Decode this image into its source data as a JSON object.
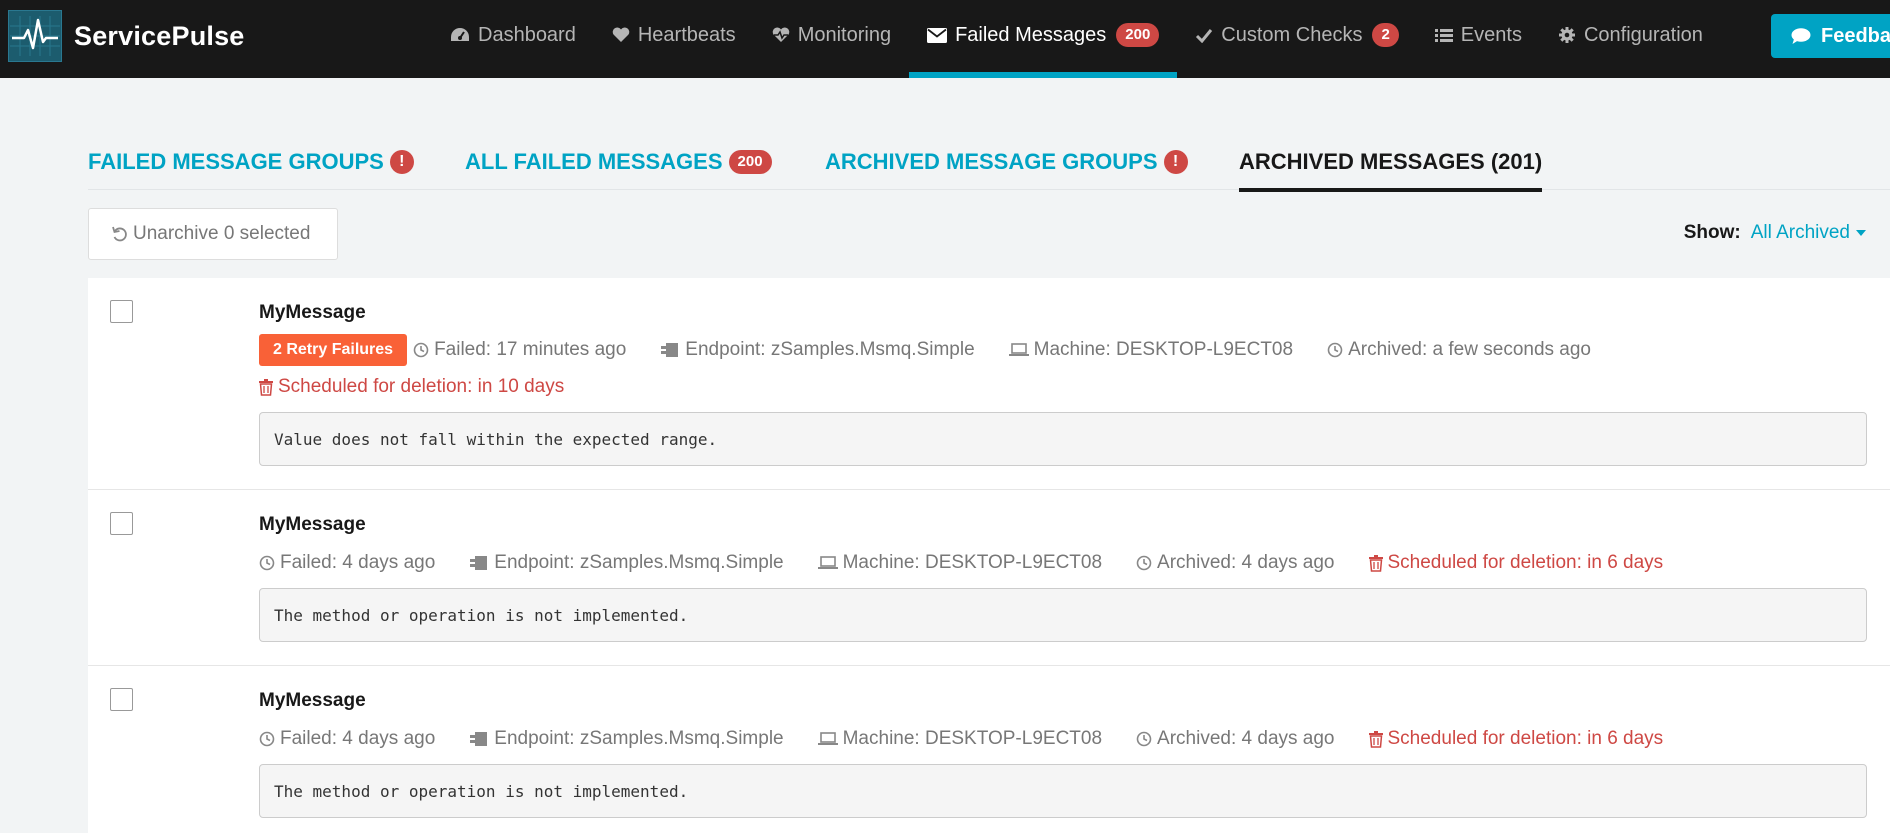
{
  "app": {
    "name": "ServicePulse"
  },
  "nav": {
    "items": [
      {
        "label": "Dashboard",
        "icon": "dashboard-icon"
      },
      {
        "label": "Heartbeats",
        "icon": "heart-icon"
      },
      {
        "label": "Monitoring",
        "icon": "heartbeat-monitor-icon"
      },
      {
        "label": "Failed Messages",
        "icon": "envelope-icon",
        "badge": "200",
        "active": true
      },
      {
        "label": "Custom Checks",
        "icon": "check-icon",
        "badge": "2"
      },
      {
        "label": "Events",
        "icon": "list-icon"
      },
      {
        "label": "Configuration",
        "icon": "gear-icon"
      }
    ],
    "feedback_label": "Feedback"
  },
  "tabs": [
    {
      "label": "FAILED MESSAGE GROUPS",
      "indicator": "!"
    },
    {
      "label": "ALL FAILED MESSAGES",
      "badge": "200"
    },
    {
      "label": "ARCHIVED MESSAGE GROUPS",
      "indicator": "!"
    },
    {
      "label": "ARCHIVED MESSAGES (201)",
      "active": true
    }
  ],
  "toolbar": {
    "unarchive_label": "Unarchive 0 selected",
    "show_label": "Show:",
    "show_value": "All Archived"
  },
  "messages": [
    {
      "title": "MyMessage",
      "retry_label": "2 Retry Failures",
      "failed": "Failed: 17 minutes ago",
      "endpoint": "Endpoint: zSamples.Msmq.Simple",
      "machine": "Machine: DESKTOP-L9ECT08",
      "archived": "Archived: a few seconds ago",
      "deletion": "Scheduled for deletion: in 10 days",
      "error": "Value does not fall within the expected range."
    },
    {
      "title": "MyMessage",
      "failed": "Failed: 4 days ago",
      "endpoint": "Endpoint: zSamples.Msmq.Simple",
      "machine": "Machine: DESKTOP-L9ECT08",
      "archived": "Archived: 4 days ago",
      "deletion": "Scheduled for deletion: in 6 days",
      "error": "The method or operation is not implemented."
    },
    {
      "title": "MyMessage",
      "failed": "Failed: 4 days ago",
      "endpoint": "Endpoint: zSamples.Msmq.Simple",
      "machine": "Machine: DESKTOP-L9ECT08",
      "archived": "Archived: 4 days ago",
      "deletion": "Scheduled for deletion: in 6 days",
      "error": "The method or operation is not implemented."
    }
  ],
  "colors": {
    "navbar": "#181818",
    "accent": "#00a3c4",
    "danger": "#ce4844",
    "retry": "#f96137",
    "background": "#f2f4f5"
  }
}
